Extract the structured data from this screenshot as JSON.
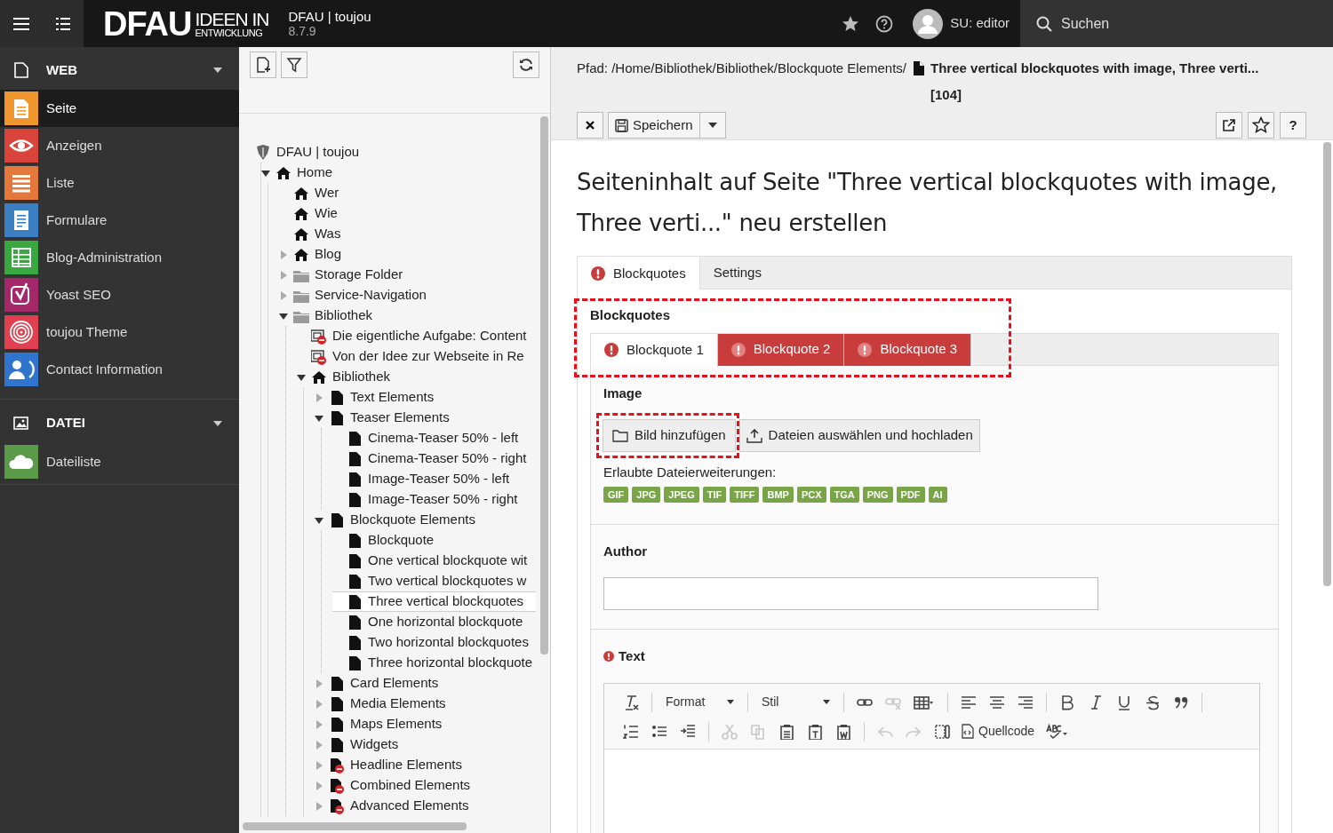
{
  "topbar": {
    "logo_main": "DFAU",
    "logo_line_1": "IDEEN IN",
    "logo_line_2": "ENTWICKLUNG",
    "site_name": "DFAU | toujou",
    "version": "8.7.9",
    "user": "SU: editor",
    "search": "Suchen"
  },
  "modules": [
    {
      "label": "WEB",
      "expanded": true,
      "items": [
        {
          "label": "Seite",
          "kind": "page",
          "color": "#f0962f",
          "selected": true
        },
        {
          "label": "Anzeigen",
          "kind": "eye",
          "color": "#d9453b",
          "selected": false
        },
        {
          "label": "Liste",
          "kind": "list",
          "color": "#e4773a",
          "selected": false
        },
        {
          "label": "Formulare",
          "kind": "form",
          "color": "#3b7ec2",
          "selected": false
        },
        {
          "label": "Blog-Administration",
          "kind": "table",
          "color": "#3aa840",
          "selected": false
        },
        {
          "label": "Yoast SEO",
          "kind": "yoast",
          "color": "#a4286a",
          "selected": false
        },
        {
          "label": "toujou Theme",
          "kind": "fingerprint",
          "color": "#e0404f",
          "selected": false
        },
        {
          "label": "Contact Information",
          "kind": "contact",
          "color": "#2f74cd",
          "selected": false
        }
      ]
    },
    {
      "label": "DATEI",
      "expanded": true,
      "items": [
        {
          "label": "Dateiliste",
          "kind": "cloud",
          "color": "#5a9a48",
          "selected": false
        }
      ]
    }
  ],
  "tree": [
    {
      "label": "DFAU | toujou",
      "kind": "site",
      "selected": false,
      "children": [
        {
          "label": "Home",
          "kind": "home",
          "expanded": true,
          "selected": false,
          "children": [
            {
              "label": "Wer",
              "kind": "home",
              "selected": false
            },
            {
              "label": "Wie",
              "kind": "home",
              "selected": false
            },
            {
              "label": "Was",
              "kind": "home",
              "selected": false
            },
            {
              "label": "Blog",
              "kind": "home",
              "expanded": false,
              "selected": false
            },
            {
              "label": "Storage Folder",
              "kind": "folder",
              "expanded": false,
              "selected": false
            },
            {
              "label": "Service-Navigation",
              "kind": "folder",
              "expanded": false,
              "selected": false
            },
            {
              "label": "Bibliothek",
              "kind": "folder",
              "expanded": true,
              "selected": false,
              "children": [
                {
                  "label": "Die eigentliche Aufgabe: Content",
                  "kind": "content-hidden",
                  "selected": false
                },
                {
                  "label": "Von der Idee zur Webseite in Re",
                  "kind": "content-hidden",
                  "selected": false
                },
                {
                  "label": "Bibliothek",
                  "kind": "home",
                  "expanded": true,
                  "selected": false,
                  "children": [
                    {
                      "label": "Text Elements",
                      "kind": "page",
                      "expanded": false,
                      "selected": false
                    },
                    {
                      "label": "Teaser Elements",
                      "kind": "page",
                      "expanded": true,
                      "selected": false,
                      "children": [
                        {
                          "label": "Cinema-Teaser 50% - left",
                          "kind": "page",
                          "selected": false
                        },
                        {
                          "label": "Cinema-Teaser 50% - right",
                          "kind": "page",
                          "selected": false
                        },
                        {
                          "label": "Image-Teaser 50% - left",
                          "kind": "page",
                          "selected": false
                        },
                        {
                          "label": "Image-Teaser 50% - right",
                          "kind": "page",
                          "selected": false
                        }
                      ]
                    },
                    {
                      "label": "Blockquote Elements",
                      "kind": "page",
                      "expanded": true,
                      "selected": false,
                      "children": [
                        {
                          "label": "Blockquote",
                          "kind": "page",
                          "selected": false
                        },
                        {
                          "label": "One vertical blockquote wit",
                          "kind": "page",
                          "selected": false
                        },
                        {
                          "label": "Two vertical blockquotes w",
                          "kind": "page",
                          "selected": false
                        },
                        {
                          "label": "Three vertical blockquotes",
                          "kind": "page",
                          "selected": true
                        },
                        {
                          "label": "One horizontal blockquote",
                          "kind": "page",
                          "selected": false
                        },
                        {
                          "label": "Two horizontal blockquotes",
                          "kind": "page",
                          "selected": false
                        },
                        {
                          "label": "Three horizontal blockquote",
                          "kind": "page",
                          "selected": false
                        }
                      ]
                    },
                    {
                      "label": "Card Elements",
                      "kind": "page",
                      "expanded": false,
                      "selected": false
                    },
                    {
                      "label": "Media Elements",
                      "kind": "page",
                      "expanded": false,
                      "selected": false
                    },
                    {
                      "label": "Maps Elements",
                      "kind": "page",
                      "expanded": false,
                      "selected": false
                    },
                    {
                      "label": "Widgets",
                      "kind": "page",
                      "expanded": false,
                      "selected": false
                    },
                    {
                      "label": "Headline Elements",
                      "kind": "page-hidden",
                      "expanded": false,
                      "selected": false
                    },
                    {
                      "label": "Combined Elements",
                      "kind": "page-hidden",
                      "expanded": false,
                      "selected": false
                    },
                    {
                      "label": "Advanced Elements",
                      "kind": "page-hidden",
                      "expanded": false,
                      "selected": false
                    }
                  ]
                }
              ]
            }
          ]
        }
      ]
    }
  ],
  "docheader": {
    "path": "Pfad: /Home/Bibliothek/Bibliothek/Blockquote Elements/",
    "page_title": "Three vertical blockquotes with image, Three verti... [104]",
    "save": "Speichern",
    "help": "?"
  },
  "heading": "Seiteninhalt auf Seite \"Three vertical blockquotes with image, Three verti...\" neu erstellen",
  "tabs": [
    {
      "label": "Blockquotes",
      "selected": true,
      "error": true
    },
    {
      "label": "Settings",
      "selected": false,
      "error": false
    }
  ],
  "section": {
    "label": "Blockquotes",
    "annotated": true,
    "tabs": [
      {
        "label": "Blockquote 1",
        "selected": true,
        "error": true
      },
      {
        "label": "Blockquote 2",
        "selected": false,
        "error": true
      },
      {
        "label": "Blockquote 3",
        "selected": false,
        "error": true
      }
    ]
  },
  "image_field": {
    "label": "Image",
    "add_button": {
      "label": "Bild hinzufügen",
      "annotated": true
    },
    "upload_button": "Dateien auswählen und hochladen",
    "allowed_label": "Erlaubte Dateierweiterungen:",
    "extensions": [
      "GIF",
      "JPG",
      "JPEG",
      "TIF",
      "TIFF",
      "BMP",
      "PCX",
      "TGA",
      "PNG",
      "PDF",
      "AI"
    ]
  },
  "author_field": {
    "label": "Author"
  },
  "text_field": {
    "label": "Text",
    "error": true,
    "toolbar": [
      [
        {
          "kind": "clear-format",
          "disabled": false
        },
        {
          "kind": "separator"
        },
        {
          "kind": "dropdown",
          "label": "Format",
          "disabled": false
        },
        {
          "kind": "separator"
        },
        {
          "kind": "dropdown",
          "label": "Stil",
          "disabled": false
        },
        {
          "kind": "separator"
        },
        {
          "kind": "link",
          "disabled": false
        },
        {
          "kind": "unlink",
          "disabled": true
        },
        {
          "kind": "table",
          "disabled": false
        },
        {
          "kind": "separator"
        },
        {
          "kind": "align-left",
          "disabled": false
        },
        {
          "kind": "align-center",
          "disabled": false
        },
        {
          "kind": "align-right",
          "disabled": false
        },
        {
          "kind": "separator"
        },
        {
          "kind": "bold",
          "disabled": false
        },
        {
          "kind": "italic",
          "disabled": false
        },
        {
          "kind": "underline",
          "disabled": false
        },
        {
          "kind": "strike",
          "disabled": false
        },
        {
          "kind": "quote",
          "disabled": false
        },
        {
          "kind": "separator"
        }
      ],
      [
        {
          "kind": "numbered-list",
          "disabled": false
        },
        {
          "kind": "bullet-list",
          "disabled": false
        },
        {
          "kind": "indent",
          "disabled": false
        },
        {
          "kind": "separator"
        },
        {
          "kind": "cut",
          "disabled": true
        },
        {
          "kind": "copy",
          "disabled": true
        },
        {
          "kind": "paste",
          "disabled": false
        },
        {
          "kind": "paste-text",
          "disabled": false
        },
        {
          "kind": "paste-word",
          "disabled": false
        },
        {
          "kind": "separator"
        },
        {
          "kind": "undo",
          "disabled": true
        },
        {
          "kind": "redo",
          "disabled": true
        },
        {
          "kind": "show-blocks",
          "disabled": false
        },
        {
          "kind": "source",
          "label": "Quellcode",
          "disabled": false
        },
        {
          "kind": "spellcheck",
          "disabled": false
        }
      ]
    ]
  }
}
